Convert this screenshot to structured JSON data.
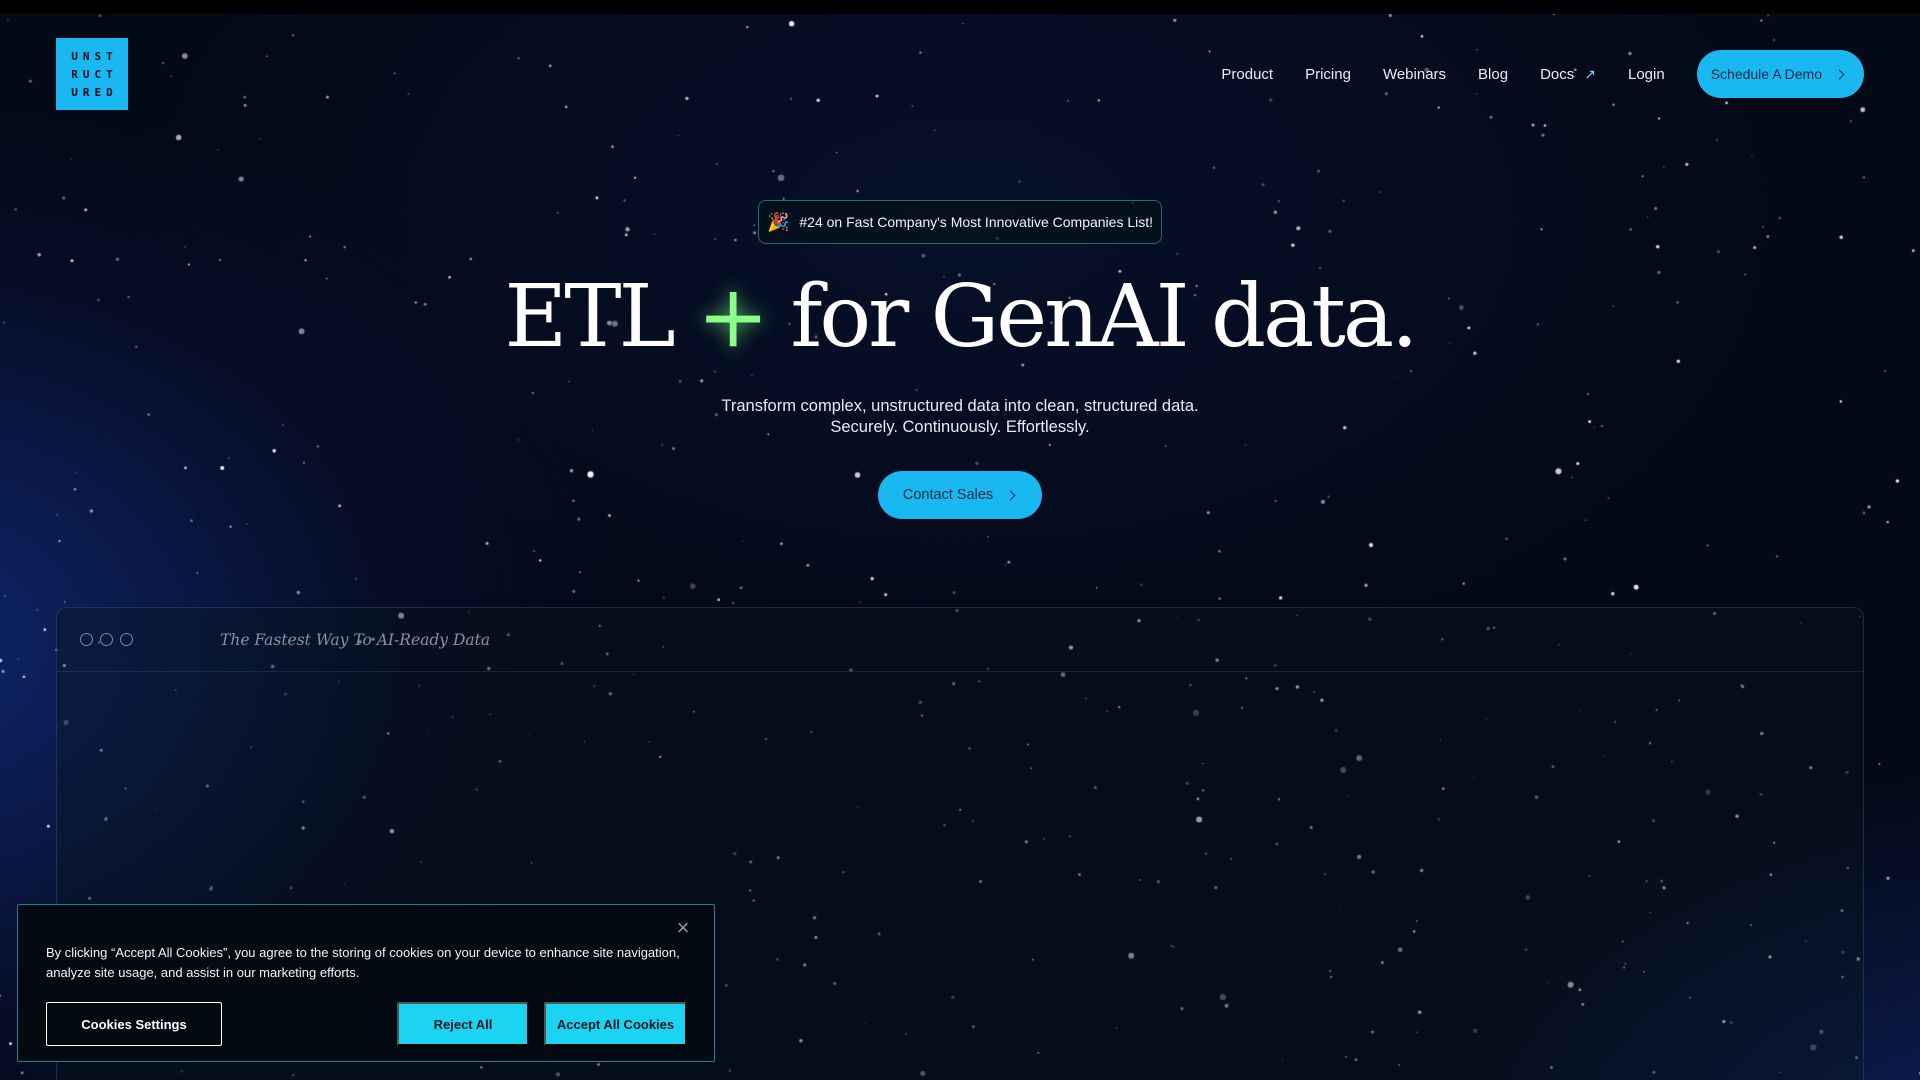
{
  "header": {
    "logo_lines": [
      "UNST",
      "RUCT",
      "URED"
    ],
    "nav": [
      {
        "label": "Product"
      },
      {
        "label": "Pricing"
      },
      {
        "label": "Webinars"
      },
      {
        "label": "Blog"
      },
      {
        "label": "Docs",
        "icon": "external-link-arrow-icon"
      },
      {
        "label": "Login"
      }
    ],
    "cta_label": "Schedule A Demo"
  },
  "hero": {
    "badge_icon": "party-popper-icon",
    "badge_text": "#24 on Fast Company's Most Innovative Companies List!",
    "title_before": "ETL",
    "title_plus": "+",
    "title_after": "for GenAI data.",
    "subtitle_line1": "Transform complex, unstructured data into clean, structured data.",
    "subtitle_line2": "Securely. Continuously. Effortlessly.",
    "cta_label": "Contact Sales"
  },
  "demo_window": {
    "title": "The Fastest Way To AI-Ready Data"
  },
  "cookie_banner": {
    "text": "By clicking “Accept All Cookies”, you agree to the storing of cookies on your device to enhance site navigation, analyze site usage, and assist in our marketing efforts.",
    "settings_label": "Cookies Settings",
    "reject_label": "Reject All",
    "accept_label": "Accept All Cookies",
    "close_icon": "close-icon"
  },
  "colors": {
    "accent": "#1ab8f0",
    "cookie_button": "#1ad4f2",
    "plus_glow": "#8cff8a",
    "background": "#040916"
  }
}
